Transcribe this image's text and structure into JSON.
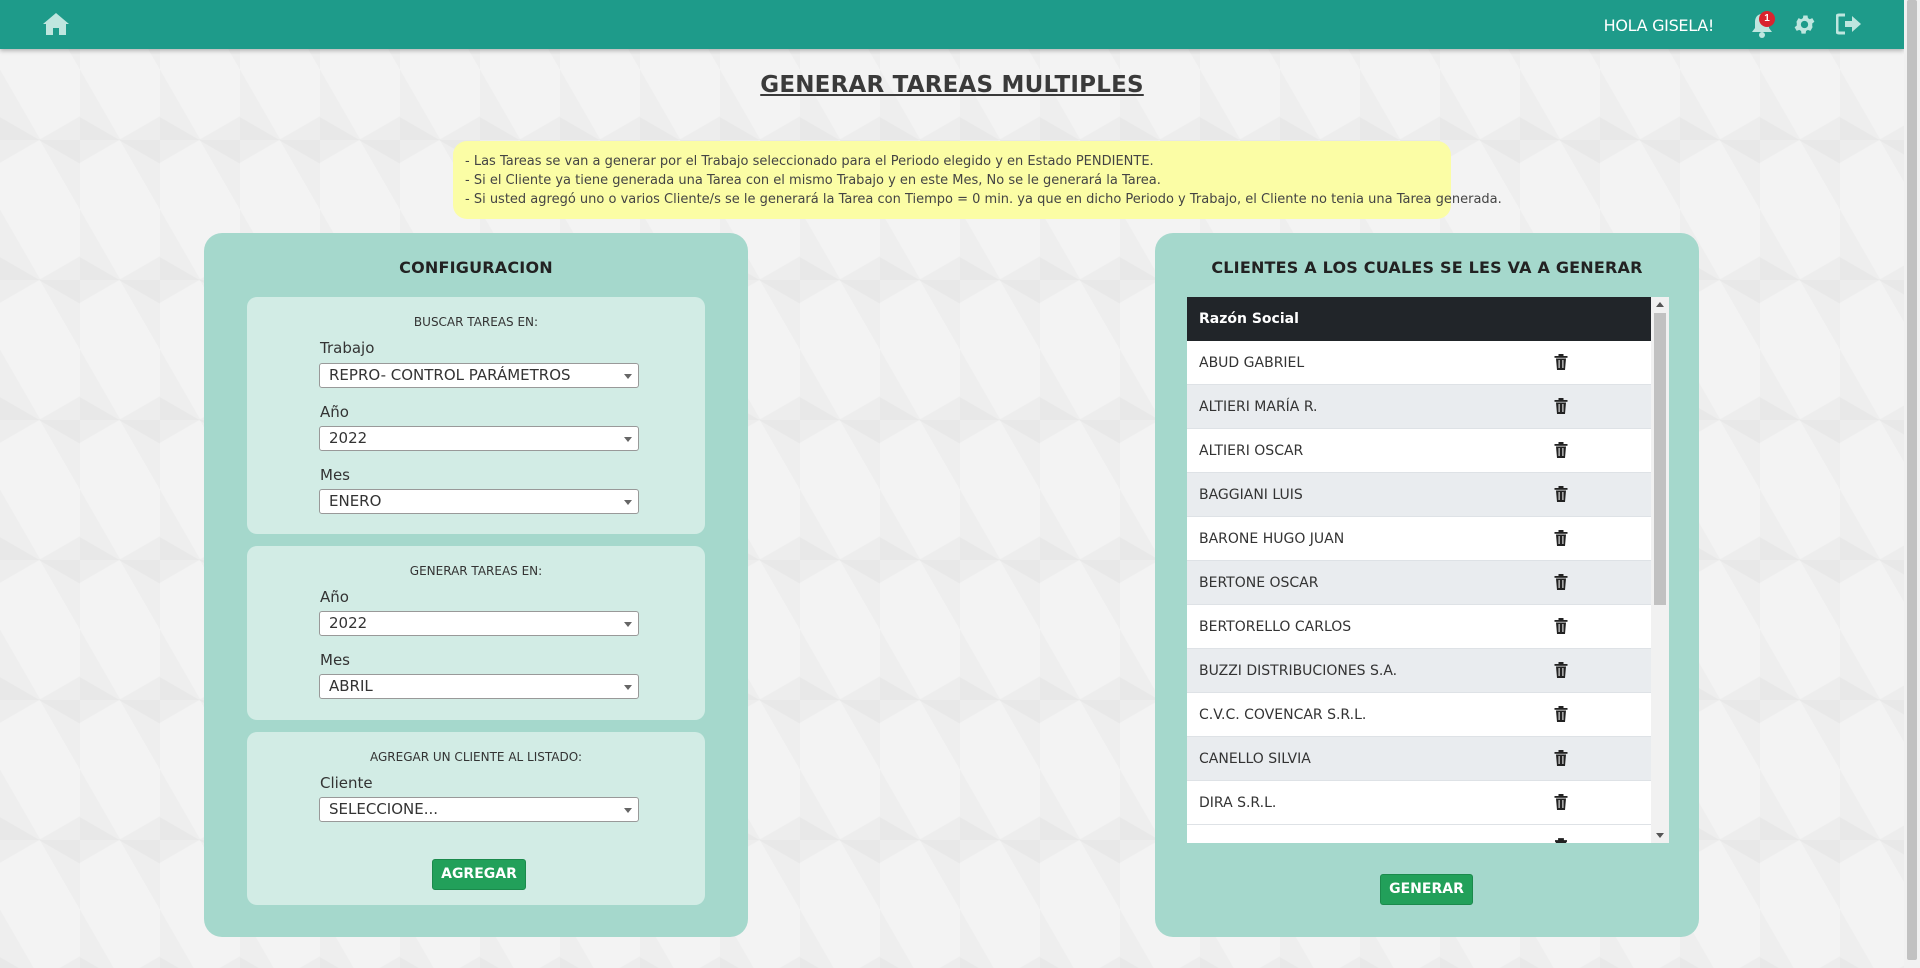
{
  "header": {
    "greeting": "HOLA GISELA!",
    "notification_count": "1",
    "icons": [
      "home-icon",
      "bell-icon",
      "gear-icon",
      "logout-icon"
    ]
  },
  "page_title": "GENERAR TAREAS MULTIPLES",
  "notice": {
    "lines": [
      "- Las Tareas se van a generar por el Trabajo seleccionado para el Periodo elegido y en Estado PENDIENTE.",
      "- Si el Cliente ya tiene generada una Tarea con el mismo Trabajo y en este Mes, No se le generará la Tarea.",
      "- Si usted agregó uno o varios Cliente/s se le generará la Tarea con Tiempo = 0 min. ya que en dicho Periodo y Trabajo, el Cliente no tenia una Tarea generada."
    ]
  },
  "config": {
    "title": "CONFIGURACION",
    "search": {
      "heading": "BUSCAR TAREAS EN:",
      "trabajo_label": "Trabajo",
      "trabajo_value": "REPRO- CONTROL PARÁMETROS",
      "anio_label": "Año",
      "anio_value": "2022",
      "mes_label": "Mes",
      "mes_value": "ENERO"
    },
    "generate": {
      "heading": "GENERAR TAREAS EN:",
      "anio_label": "Año",
      "anio_value": "2022",
      "mes_label": "Mes",
      "mes_value": "ABRIL"
    },
    "add_client": {
      "heading": "AGREGAR UN CLIENTE AL LISTADO:",
      "cliente_label": "Cliente",
      "cliente_value": "SELECCIONE...",
      "button": "AGREGAR"
    }
  },
  "clients": {
    "title": "CLIENTES A LOS CUALES SE LES VA A GENERAR",
    "column_header": "Razón Social",
    "rows": [
      "ABUD GABRIEL",
      "ALTIERI MARÍA R.",
      "ALTIERI OSCAR",
      "BAGGIANI LUIS",
      "BARONE HUGO JUAN",
      "BERTONE OSCAR",
      "BERTORELLO CARLOS",
      "BUZZI DISTRIBUCIONES S.A.",
      "C.V.C. COVENCAR S.R.L.",
      "CANELLO SILVIA",
      "DIRA S.R.L."
    ],
    "button": "GENERAR"
  },
  "colors": {
    "topbar": "#1e9b8a",
    "panel": "#a5d8cc",
    "box": "#d2ece5",
    "button": "#22a05a",
    "notice": "#fbfda5"
  }
}
